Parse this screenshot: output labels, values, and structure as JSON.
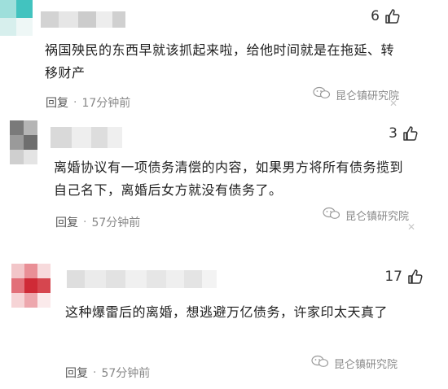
{
  "comments": [
    {
      "likes": "6",
      "text": "祸国殃民的东西早就该抓起来啦，给他时间就是在拖延、转移财产",
      "reply_label": "回复",
      "dot": "·",
      "time": "17分钟前",
      "watermark": "昆仑镇研究院"
    },
    {
      "likes": "3",
      "text": "离婚协议有一项债务清偿的内容，如果男方将所有债务揽到自己名下，离婚后女方就没有债务了。",
      "reply_label": "回复",
      "dot": "·",
      "time": "57分钟前",
      "watermark": "昆仑镇研究院"
    },
    {
      "likes": "17",
      "text": "这种爆雷后的离婚，想逃避万亿债务，许家印太天真了",
      "reply_label": "回复",
      "dot": "·",
      "time": "57分钟前",
      "watermark": "昆仑镇研究院"
    }
  ],
  "colors": {
    "accent_teal": "#3fc4c0",
    "accent_red": "#d4343f"
  }
}
